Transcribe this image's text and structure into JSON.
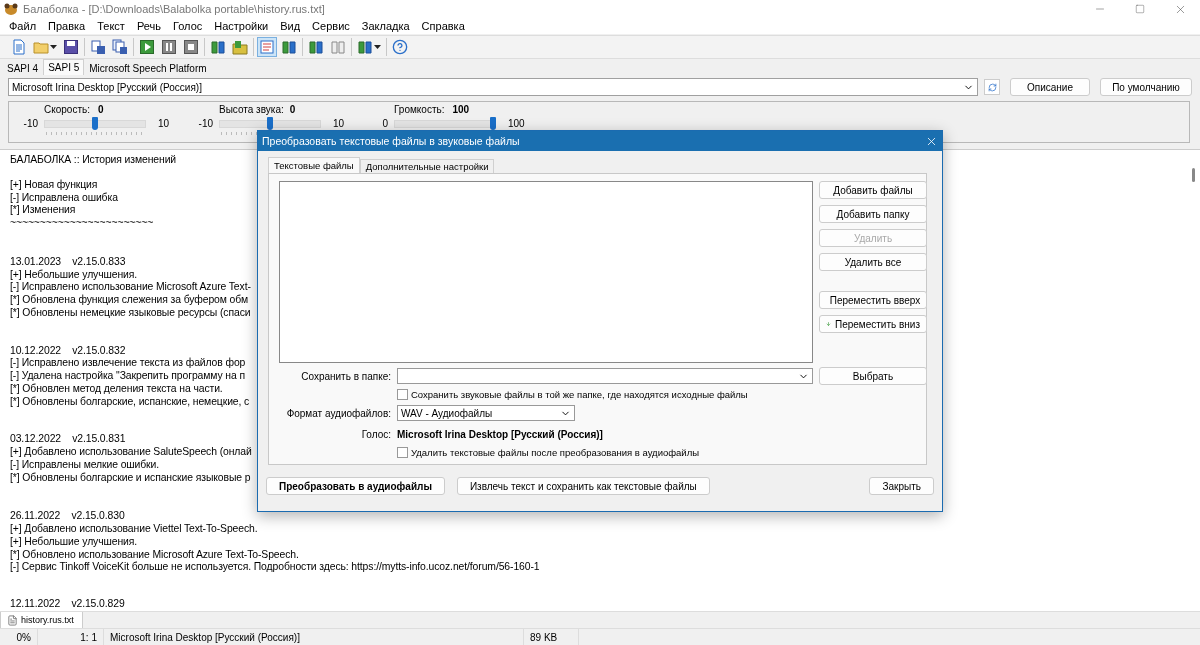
{
  "window": {
    "title": "Балаболка - [D:\\Downloads\\Balabolka portable\\history.rus.txt]"
  },
  "menu": [
    "Файл",
    "Правка",
    "Текст",
    "Речь",
    "Голос",
    "Настройки",
    "Вид",
    "Сервис",
    "Закладка",
    "Справка"
  ],
  "toolbar": {
    "groups": [
      [
        {
          "kind": "new",
          "pressed": false,
          "dropdown": false
        },
        {
          "kind": "open",
          "pressed": false,
          "dropdown": true
        },
        {
          "kind": "save",
          "pressed": false,
          "dropdown": false
        }
      ],
      [
        {
          "kind": "export",
          "pressed": false,
          "dropdown": false
        },
        {
          "kind": "batch",
          "pressed": false,
          "dropdown": false
        }
      ],
      [
        {
          "kind": "play",
          "pressed": false,
          "dropdown": false
        },
        {
          "kind": "pause",
          "pressed": false,
          "dropdown": false
        },
        {
          "kind": "stop",
          "pressed": false,
          "dropdown": false
        }
      ],
      [
        {
          "kind": "book",
          "pressed": false,
          "dropdown": false
        },
        {
          "kind": "folder",
          "pressed": false,
          "dropdown": false
        }
      ],
      [
        {
          "kind": "notes",
          "pressed": true,
          "dropdown": false
        },
        {
          "kind": "book",
          "pressed": false,
          "dropdown": false
        }
      ],
      [
        {
          "kind": "book",
          "pressed": false,
          "dropdown": false
        },
        {
          "kind": "grey",
          "pressed": false,
          "dropdown": false
        }
      ],
      [
        {
          "kind": "book",
          "pressed": false,
          "dropdown": true
        }
      ],
      [
        {
          "kind": "help",
          "pressed": false,
          "dropdown": false
        }
      ]
    ]
  },
  "engine_tabs": [
    {
      "label": "SAPI 4",
      "selected": false
    },
    {
      "label": "SAPI 5",
      "selected": true
    },
    {
      "label": "Microsoft Speech Platform",
      "selected": false
    }
  ],
  "voice": {
    "value": "Microsoft Irina Desktop [Русский (Россия)]",
    "buttons": [
      "Описание",
      "По умолчанию"
    ]
  },
  "sliders": [
    {
      "label": "Скорость:",
      "reading": "0",
      "min": "-10",
      "max": "10",
      "level": 0.5
    },
    {
      "label": "Высота звука:",
      "reading": "0",
      "min": "-10",
      "max": "10",
      "level": 0.5
    },
    {
      "label": "Громкость:",
      "reading": "100",
      "min": "0",
      "max": "100",
      "level": 1
    }
  ],
  "editor": {
    "blocks": [
      [
        "БАЛАБОЛКА :: История изменений"
      ],
      [
        "[+] Новая функция",
        "[-] Исправлена ошибка",
        "[*] Изменения",
        "~~~~~~~~~~~~~~~~~~~~~~~~"
      ],
      [
        "13.01.2023    v2.15.0.833",
        "[+] Небольшие улучшения.",
        "[-] Исправлено использование Microsoft Azure Text-",
        "[*] Обновлена функция слежения за буфером обм",
        "[*] Обновлены немецкие языковые ресурсы (спаси"
      ],
      [
        "10.12.2022    v2.15.0.832",
        "[-] Исправлено извлечение текста из файлов фор",
        "[-] Удалена настройка \"Закрепить программу на п",
        "[*] Обновлен метод деления текста на части.",
        "[*] Обновлены болгарские, испанские, немецкие, с"
      ],
      [
        "03.12.2022    v2.15.0.831",
        "[+] Добавлено использование SaluteSpeech (онлай",
        "[-] Исправлены мелкие ошибки.",
        "[*] Обновлены болгарские и испанские языковые р"
      ],
      [
        "26.11.2022    v2.15.0.830",
        "[+] Добавлено использование Viettel Text-To-Speech.",
        "[+] Небольшие улучшения.",
        "[*] Обновлено использование Microsoft Azure Text-To-Speech.",
        "[-] Сервис Tinkoff VoiceKit больше не используется. Подробности здесь: https://mytts-info.ucoz.net/forum/56-160-1"
      ],
      [
        "12.11.2022    v2.15.0.829"
      ]
    ]
  },
  "documents": [
    {
      "label": "history.rus.txt",
      "selected": true
    }
  ],
  "status_bar": [
    "0%",
    "1: 1",
    "Microsoft Irina Desktop [Русский (Россия)]",
    "89 KB"
  ],
  "dialog": {
    "title": "Преобразовать текстовые файлы в звуковые файлы",
    "tabs": [
      {
        "label": "Текстовые файлы",
        "selected": true
      },
      {
        "label": "Дополнительные настройки",
        "selected": false
      }
    ],
    "file_buttons": [
      {
        "label": "Добавить файлы",
        "kind": "plain",
        "disabled": false
      },
      {
        "label": "Добавить папку",
        "kind": "plain",
        "disabled": false
      },
      {
        "label": "Удалить",
        "kind": "plain",
        "disabled": true
      },
      {
        "label": "Удалить все",
        "kind": "plain",
        "disabled": false
      },
      {
        "label": "Переместить вверх",
        "kind": "up",
        "disabled": false
      },
      {
        "label": "Переместить вниз",
        "kind": "down",
        "disabled": false
      }
    ],
    "save_folder": {
      "label": "Сохранить в папке:",
      "button": "Выбрать"
    },
    "same_folder": {
      "label": "Сохранить звуковые файлы в той же папке, где находятся исходные файлы",
      "checked": false
    },
    "format": {
      "label": "Формат аудиофайлов:",
      "value": "WAV - Аудиофайлы"
    },
    "voice": {
      "label": "Голос:",
      "value": "Microsoft Irina Desktop [Русский (Россия)]"
    },
    "delete_after": {
      "label": "Удалить текстовые файлы после преобразования в аудиофайлы",
      "checked": false
    },
    "buttons": [
      {
        "label": "Преобразовать в аудиофайлы",
        "default": true
      },
      {
        "label": "Извлечь текст и сохранить как текстовые файлы",
        "default": false
      },
      {
        "label": "Закрыть",
        "default": false
      }
    ]
  }
}
